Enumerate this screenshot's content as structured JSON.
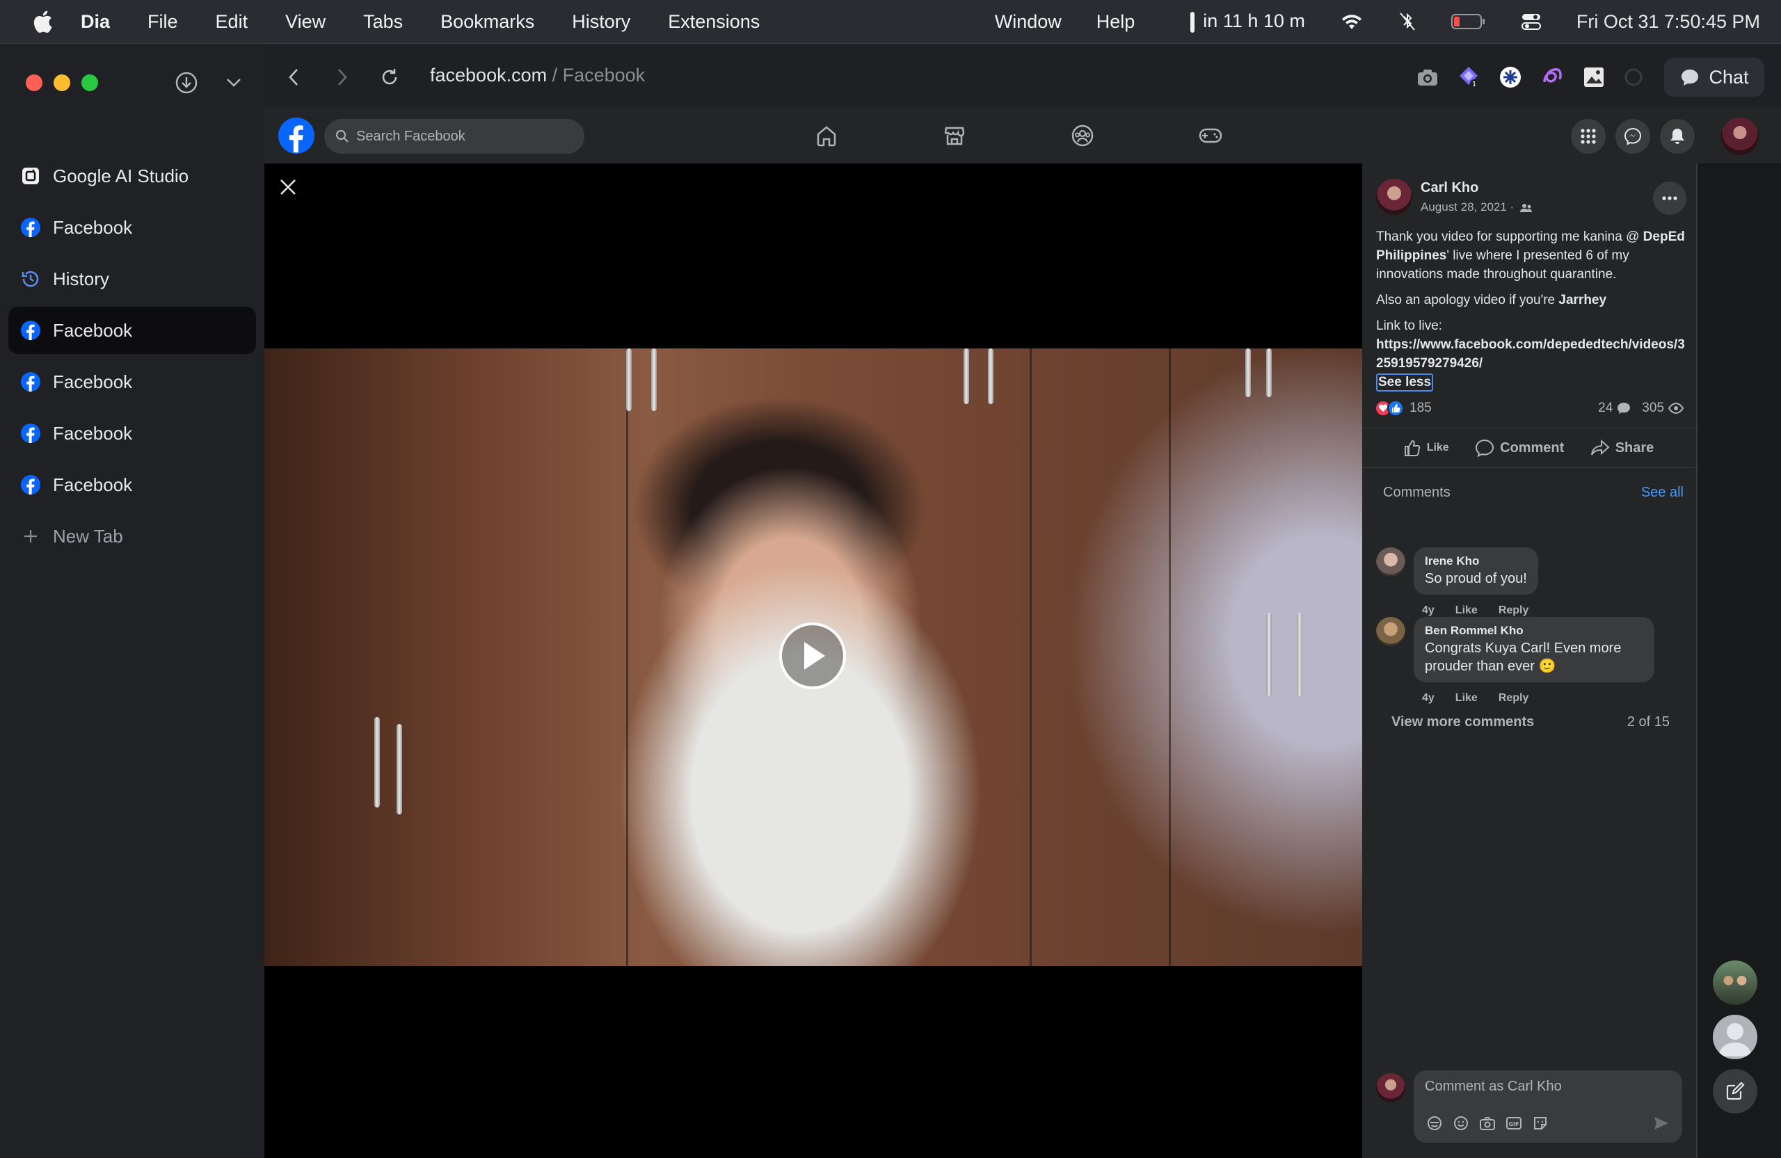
{
  "menubar": {
    "app_name": "Dia",
    "items": [
      "File",
      "Edit",
      "View",
      "Tabs",
      "Bookmarks",
      "History",
      "Extensions"
    ],
    "right_items": [
      "Window",
      "Help"
    ],
    "timer": "in 11 h 10 m",
    "datetime": "Fri Oct 31  7:50:45 PM"
  },
  "sidebar": {
    "tabs": [
      {
        "label": "Google AI Studio",
        "icon": "ai-studio-icon",
        "active": false
      },
      {
        "label": "Facebook",
        "icon": "facebook-icon",
        "active": false
      },
      {
        "label": "History",
        "icon": "history-icon",
        "active": false
      },
      {
        "label": "Facebook",
        "icon": "facebook-icon",
        "active": true
      },
      {
        "label": "Facebook",
        "icon": "facebook-icon",
        "active": false
      },
      {
        "label": "Facebook",
        "icon": "facebook-icon",
        "active": false
      },
      {
        "label": "Facebook",
        "icon": "facebook-icon",
        "active": false
      }
    ],
    "new_tab_label": "New Tab"
  },
  "toolbar": {
    "url_domain": "facebook.com",
    "url_separator": " / ",
    "url_title": "Facebook",
    "chat_label": "Chat"
  },
  "facebook": {
    "search_placeholder": "Search Facebook",
    "accent": "#0866ff"
  },
  "post": {
    "author": "Carl Kho",
    "date": "August 28, 2021 ·",
    "body_line1_pre": "Thank you video for supporting me kanina @ ",
    "body_line1_bold": "DepEd Philippines",
    "body_line1_post": "' live where I presented 6 of my innovations made throughout quarantine.",
    "body_line2_pre": "Also an apology video if you're ",
    "body_line2_bold": "Jarrhey",
    "body_line3": "Link to live:",
    "body_link": "https://www.facebook.com/depededtech/videos/325919579279426/",
    "see_less": "See less",
    "reaction_count": "185",
    "comment_count": "24",
    "view_count": "305",
    "actions": {
      "like": "Like",
      "comment": "Comment",
      "share": "Share"
    }
  },
  "comments": {
    "header": "Comments",
    "see_all": "See all",
    "items": [
      {
        "name": "Irene Kho",
        "text": "So proud of you!",
        "age": "4y",
        "like": "Like",
        "reply": "Reply"
      },
      {
        "name": "Ben Rommel Kho",
        "text": "Congrats Kuya Carl! Even more prouder than ever 🙂",
        "age": "4y",
        "like": "Like",
        "reply": "Reply"
      }
    ],
    "view_more": "View more comments",
    "count": "2 of 15",
    "input_placeholder": "Comment as Carl Kho"
  }
}
